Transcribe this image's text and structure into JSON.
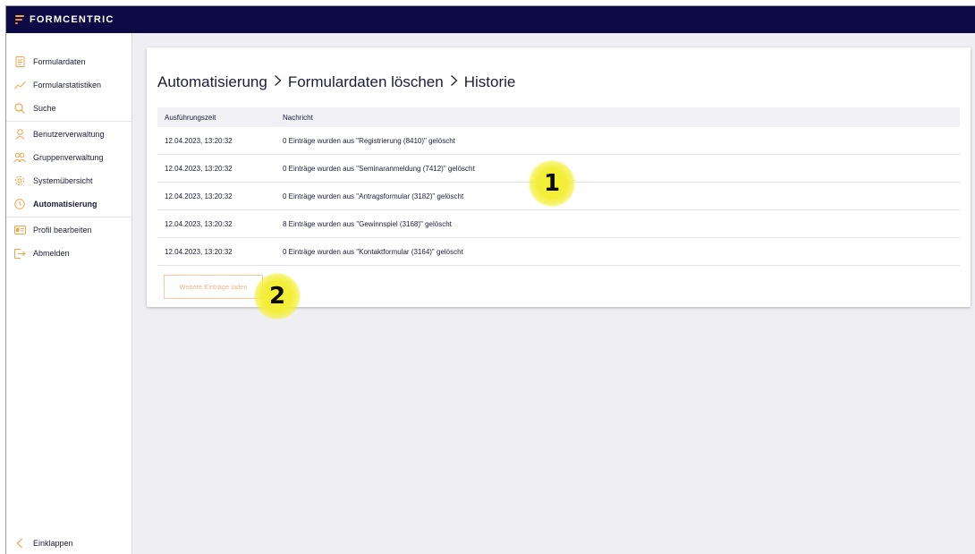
{
  "app": {
    "brand": "FORMCENTRIC"
  },
  "sidebar": {
    "group1": [
      {
        "label": "Formulardaten",
        "icon": "document-icon"
      },
      {
        "label": "Formularstatistiken",
        "icon": "chart-line-icon"
      },
      {
        "label": "Suche",
        "icon": "search-icon"
      }
    ],
    "group2": [
      {
        "label": "Benutzerverwaltung",
        "icon": "user-icon"
      },
      {
        "label": "Gruppenverwaltung",
        "icon": "users-icon"
      },
      {
        "label": "Systemübersicht",
        "icon": "gear-icon"
      },
      {
        "label": "Automatisierung",
        "icon": "clock-icon",
        "active": true
      }
    ],
    "group3": [
      {
        "label": "Profil bearbeiten",
        "icon": "id-card-icon"
      },
      {
        "label": "Abmelden",
        "icon": "logout-icon"
      }
    ],
    "collapse_label": "Einklappen"
  },
  "breadcrumb": [
    "Automatisierung",
    "Formulardaten löschen",
    "Historie"
  ],
  "table": {
    "headers": {
      "time": "Ausführungszeit",
      "message": "Nachricht"
    },
    "rows": [
      {
        "time": "12.04.2023, 13:20:32",
        "message": "0 Einträge wurden aus \"Registrierung (8410)\" gelöscht"
      },
      {
        "time": "12.04.2023, 13:20:32",
        "message": "0 Einträge wurden aus \"Seminaranmeldung (7412)\" gelöscht"
      },
      {
        "time": "12.04.2023, 13:20:32",
        "message": "0 Einträge wurden aus \"Antragsformular (3182)\" gelöscht"
      },
      {
        "time": "12.04.2023, 13:20:32",
        "message": "8 Einträge wurden aus \"Gewinnspiel (3168)\" gelöscht"
      },
      {
        "time": "12.04.2023, 13:20:32",
        "message": "0 Einträge wurden aus \"Kontaktformular (3164)\" gelöscht"
      }
    ]
  },
  "load_more_label": "Weitere Einträge laden",
  "annotations": [
    "1",
    "2"
  ],
  "colors": {
    "topbar": "#0d0a45",
    "accent": "#f2a44a",
    "marker": "#f4f02a"
  }
}
